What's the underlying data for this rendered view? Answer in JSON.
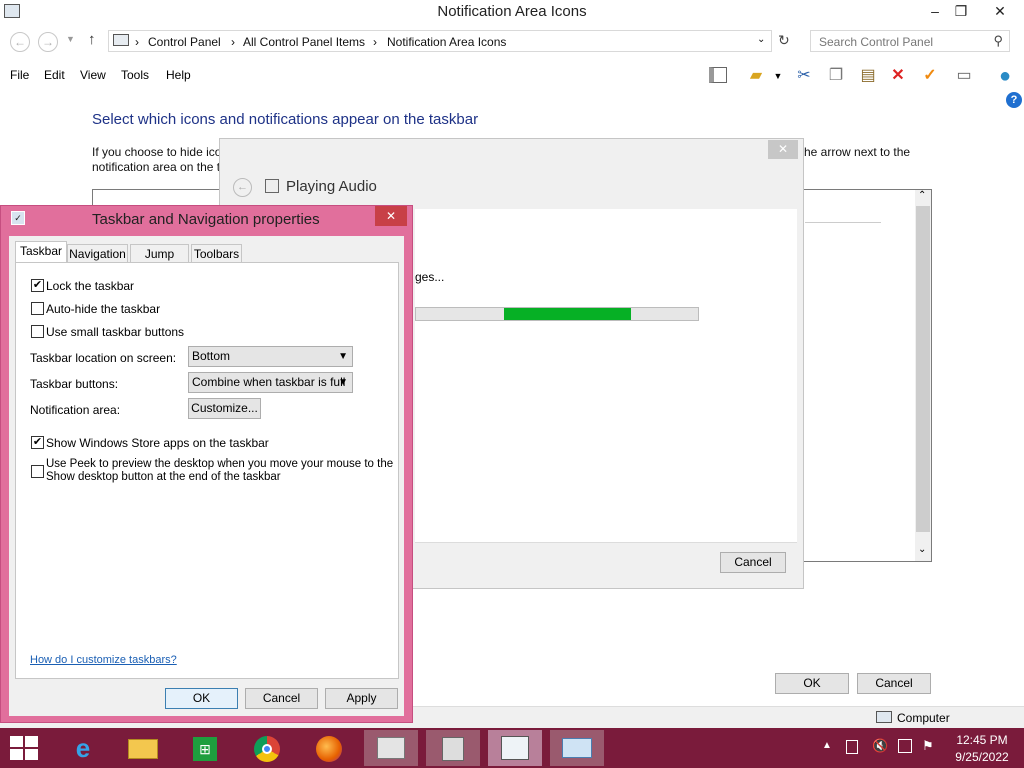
{
  "window": {
    "title": "Notification Area Icons",
    "minimize": "–",
    "restore": "❐",
    "close": "✕"
  },
  "address": {
    "crumbs": [
      "Control Panel",
      "All Control Panel Items",
      "Notification Area Icons"
    ],
    "separator": "›",
    "search_placeholder": "Search Control Panel"
  },
  "menu": [
    "File",
    "Edit",
    "View",
    "Tools",
    "Help"
  ],
  "main": {
    "heading": "Select which icons and notifications appear on the taskbar",
    "desc_left_line1": "If you choose to hide ico",
    "desc_left_line2": "notification area on the t",
    "desc_right": "he arrow next to the",
    "ok": "OK",
    "cancel": "Cancel"
  },
  "status": {
    "computer": "Computer"
  },
  "audio_dialog": {
    "title": "Playing Audio",
    "status_fragment": "ges...",
    "progress": 0.4,
    "cancel": "Cancel",
    "close": "✕"
  },
  "props_dialog": {
    "title": "Taskbar and Navigation properties",
    "close": "✕",
    "tabs": [
      "Taskbar",
      "Navigation",
      "Jump Lists",
      "Toolbars"
    ],
    "lock": "Lock the taskbar",
    "autohide": "Auto-hide the taskbar",
    "small_buttons": "Use small taskbar buttons",
    "location_label": "Taskbar location on screen:",
    "location_value": "Bottom",
    "buttons_label": "Taskbar buttons:",
    "buttons_value": "Combine when taskbar is full",
    "notif_label": "Notification area:",
    "customize": "Customize...",
    "store_apps": "Show Windows Store apps on the taskbar",
    "peek_line1": "Use Peek to preview the desktop when you move your mouse to the",
    "peek_line2": "Show desktop button at the end of the taskbar",
    "help_link": "How do I customize taskbars?",
    "ok": "OK",
    "cancel": "Cancel",
    "apply": "Apply",
    "checked": {
      "lock": true,
      "autohide": false,
      "small": false,
      "store": true,
      "peek": false
    }
  },
  "taskbar": {
    "time": "12:45 PM",
    "date": "9/25/2022"
  },
  "colors": {
    "accent_pink": "#e16f9c",
    "taskbar": "#7a1b3b",
    "progress_green": "#06b025",
    "heading_blue": "#1e3287"
  }
}
